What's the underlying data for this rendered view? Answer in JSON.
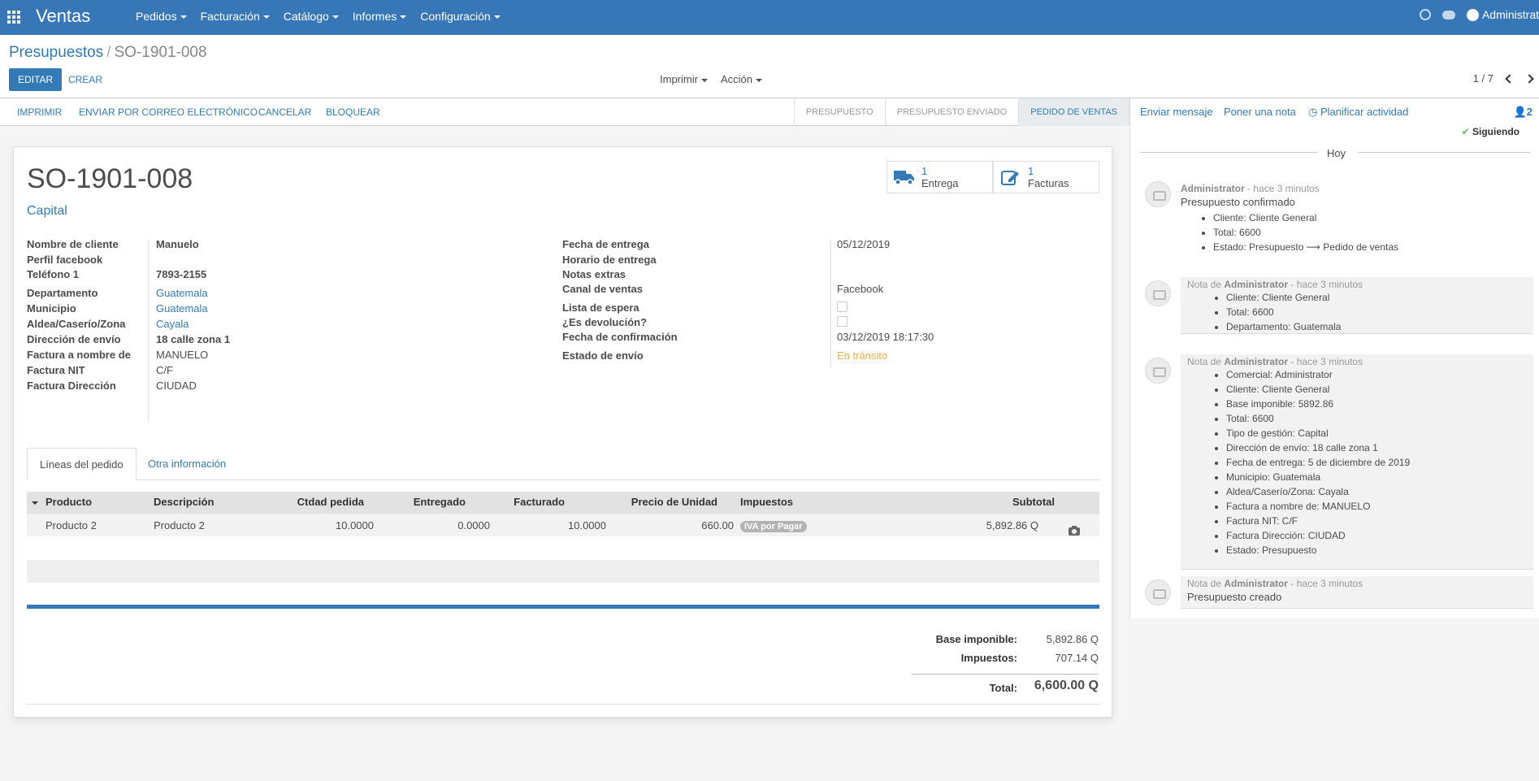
{
  "app": {
    "title": "Ventas",
    "user": "Administrat"
  },
  "nav": {
    "menu": [
      "Pedidos",
      "Facturación",
      "Catálogo",
      "Informes",
      "Configuración"
    ]
  },
  "breadcrumb": {
    "parent": "Presupuestos",
    "current": "SO-1901-008"
  },
  "buttons": {
    "edit": "EDITAR",
    "create": "CREAR"
  },
  "sidebar": {
    "print": "Imprimir",
    "action": "Acción"
  },
  "pager": {
    "value": "1 / 7"
  },
  "statusbar": {
    "buttons": [
      "IMPRIMIR",
      "ENVIAR POR CORREO ELECTRÓNICO",
      "CANCELAR",
      "BLOQUEAR"
    ],
    "stages": [
      "PRESUPUESTO",
      "PRESUPUESTO ENVIADO",
      "PEDIDO DE VENTAS"
    ],
    "active_stage": "PEDIDO DE VENTAS"
  },
  "smart_buttons": [
    {
      "count": "1",
      "label": "Entrega",
      "icon": "truck-icon"
    },
    {
      "count": "1",
      "label": "Facturas",
      "icon": "edit-icon"
    }
  ],
  "record": {
    "name": "SO-1901-008",
    "subtitle": "Capital",
    "left": [
      {
        "label": "Nombre de cliente",
        "value": "Manuelo"
      },
      {
        "label": "Perfil facebook",
        "value": ""
      },
      {
        "label": "Teléfono 1",
        "value": "7893-2155"
      },
      {
        "label": "Departamento",
        "value": "Guatemala"
      },
      {
        "label": "Municipio",
        "value": "Guatemala"
      },
      {
        "label": "Aldea/Caserío/Zona",
        "value": "Cayala"
      },
      {
        "label": "Dirección de envío",
        "value": "18 calle zona 1"
      },
      {
        "label": "Factura a nombre de",
        "value": "MANUELO"
      },
      {
        "label": "Factura NIT",
        "value": "C/F"
      },
      {
        "label": "Factura Dirección",
        "value": "CIUDAD"
      }
    ],
    "right": [
      {
        "label": "Fecha de entrega",
        "value": "05/12/2019"
      },
      {
        "label": "Horario de entrega",
        "value": ""
      },
      {
        "label": "Notas extras",
        "value": ""
      },
      {
        "label": "Canal de ventas",
        "value": "Facebook"
      },
      {
        "label": "Lista de espera",
        "value": ""
      },
      {
        "label": "¿Es devolución?",
        "value": ""
      },
      {
        "label": "Fecha de confirmación",
        "value": "03/12/2019 18:17:30"
      },
      {
        "label": "Estado de envío",
        "value": "En tránsito"
      }
    ]
  },
  "tabs": [
    "Líneas del pedido",
    "Otra información"
  ],
  "table": {
    "headers": [
      "Producto",
      "Descripción",
      "Ctdad pedida",
      "Entregado",
      "Facturado",
      "Precio de Unidad",
      "Impuestos",
      "Subtotal"
    ],
    "rows": [
      [
        "Producto 2",
        "Producto 2",
        "10.0000",
        "0.0000",
        "10.0000",
        "660.00",
        "IVA por Pagar",
        "5,892.86 Q"
      ]
    ]
  },
  "totals": {
    "base_label": "Base imponible:",
    "base": "5,892.86 Q",
    "tax_label": "Impuestos:",
    "tax": "707.14 Q",
    "total_label": "Total:",
    "total": "6,600.00 Q"
  },
  "chatter": {
    "buttons": [
      "Enviar mensaje",
      "Poner una nota",
      "Planificar actividad"
    ],
    "followers": "2",
    "following": "Siguiendo",
    "today": "Hoy",
    "messages": [
      {
        "author": "Administrator",
        "time": " - hace 3 minutos",
        "text": "Presupuesto confirmado",
        "items": [
          "Cliente: Cliente General",
          "Total: 6600",
          "Estado: Presupuesto ⟶ Pedido de ventas"
        ]
      },
      {
        "prefix": "Nota de ",
        "author": "Administrator",
        "time": " - hace 3 minutos",
        "items": [
          "Cliente: Cliente General",
          "Total: 6600",
          "Departamento: Guatemala"
        ]
      },
      {
        "prefix": "Nota de ",
        "author": "Administrator",
        "time": " - hace 3 minutos",
        "items": [
          "Comercial: Administrator",
          "Cliente: Cliente General",
          "Base imponible: 5892.86",
          "Total: 6600",
          "Tipo de gestión: Capital",
          "Dirección de envío: 18 calle zona 1",
          "Fecha de entrega: 5 de diciembre de 2019",
          "Municipio: Guatemala",
          "Aldea/Caserío/Zona: Cayala",
          "Factura a nombre de: MANUELO",
          "Factura NIT: C/F",
          "Factura Dirección: CIUDAD",
          "Estado: Presupuesto"
        ]
      },
      {
        "prefix": "Nota de ",
        "author": "Administrator",
        "time": " - hace 3 minutos",
        "text": "Presupuesto creado"
      }
    ]
  },
  "colors": {
    "brand": "#3777b7",
    "link": "#337ab7",
    "warning": "#f0ad4e"
  }
}
